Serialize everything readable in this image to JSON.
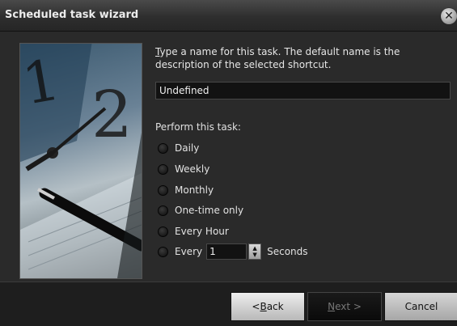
{
  "window": {
    "title": "Scheduled task wizard"
  },
  "instruction": {
    "accel": "T",
    "rest": "ype a name for this task.  The default name is the description of the selected shortcut."
  },
  "task_name": {
    "value": "Undefined"
  },
  "schedule": {
    "label": "Perform this task:",
    "options": [
      {
        "label": "Daily"
      },
      {
        "label": "Weekly"
      },
      {
        "label": "Monthly"
      },
      {
        "label": "One-time only"
      },
      {
        "label": "Every Hour"
      }
    ],
    "every": {
      "label": "Every",
      "value": "1",
      "unit": "Seconds"
    }
  },
  "buttons": {
    "back_prefix": "< ",
    "back_accel": "B",
    "back_rest": "ack",
    "next_accel": "N",
    "next_rest": "ext >",
    "cancel": "Cancel"
  },
  "icons": {
    "close": "close-icon",
    "spinner_up": "spinner-up-icon",
    "spinner_down": "spinner-down-icon"
  }
}
